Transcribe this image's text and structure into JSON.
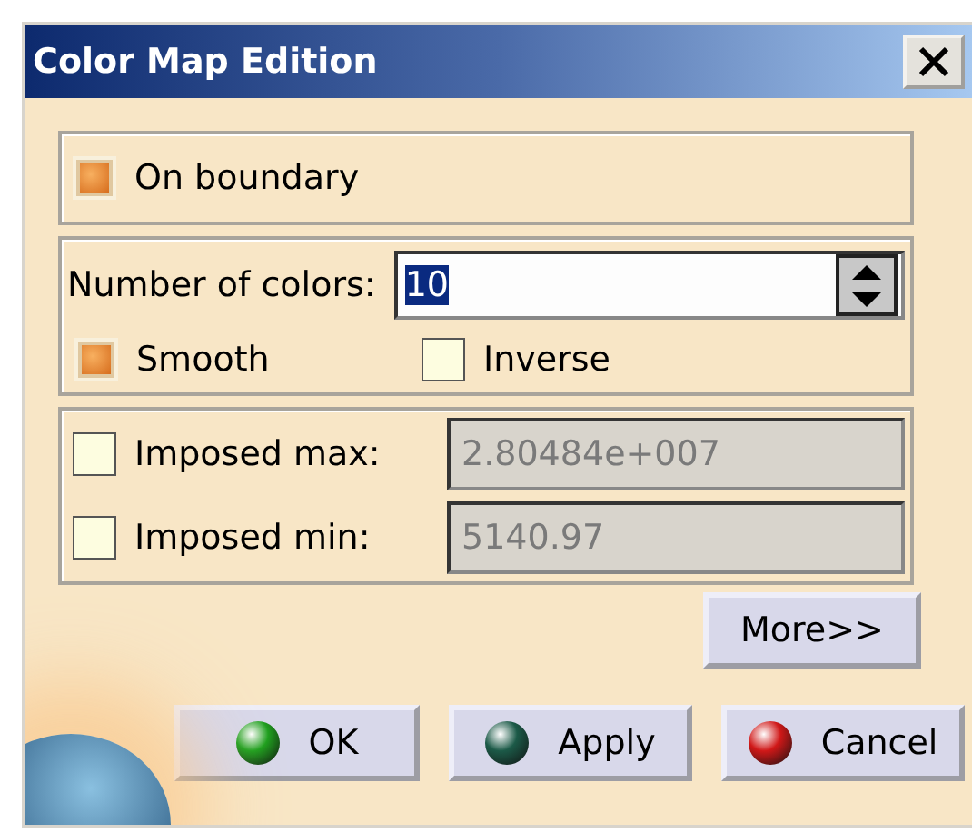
{
  "window": {
    "title": "Color Map Edition"
  },
  "on_boundary": {
    "label": "On boundary",
    "checked": true
  },
  "number_of_colors": {
    "label": "Number of colors:",
    "value": "10",
    "value_selected": true
  },
  "options": [
    {
      "label": "Smooth",
      "checked": true
    },
    {
      "label": "Inverse",
      "checked": false
    }
  ],
  "imposed": [
    {
      "label": "Imposed max:",
      "checked": false,
      "value": "2.80484e+007",
      "disabled": true
    },
    {
      "label": "Imposed min:",
      "checked": false,
      "value": "5140.97",
      "disabled": true
    }
  ],
  "more_button": "More>>",
  "buttons": [
    {
      "label": "OK",
      "kind": "ok"
    },
    {
      "label": "Apply",
      "kind": "apply"
    },
    {
      "label": "Cancel",
      "kind": "cancel"
    }
  ]
}
